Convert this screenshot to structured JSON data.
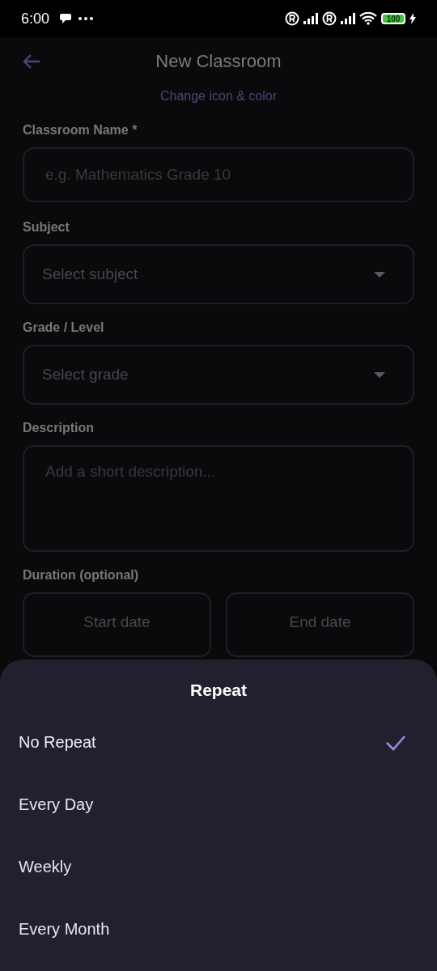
{
  "status_bar": {
    "time": "6:00",
    "battery": "100"
  },
  "app_bar": {
    "title": "New Classroom"
  },
  "change_link": "Change icon & color",
  "fields": [
    {
      "kind": "text",
      "label": "Classroom Name *",
      "placeholder": "e.g. Mathematics Grade 10"
    },
    {
      "kind": "select",
      "label": "Subject",
      "placeholder": "Select subject"
    },
    {
      "kind": "select",
      "label": "Grade / Level",
      "placeholder": "Select grade"
    },
    {
      "kind": "textarea",
      "label": "Description",
      "placeholder": "Add a short description..."
    },
    {
      "kind": "dates",
      "label": "Duration (optional)",
      "start": "Start date",
      "end": "End date"
    }
  ],
  "sheet": {
    "title": "Repeat",
    "options": [
      {
        "label": "No Repeat",
        "selected": true
      },
      {
        "label": "Every Day",
        "selected": false
      },
      {
        "label": "Weekly",
        "selected": false
      },
      {
        "label": "Every Month",
        "selected": false
      }
    ]
  }
}
